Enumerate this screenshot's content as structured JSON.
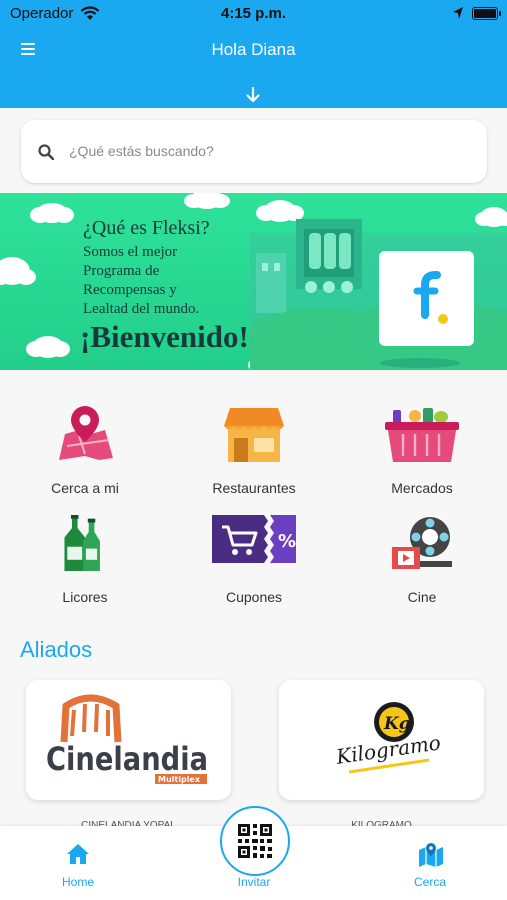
{
  "status_bar": {
    "carrier": "Operador",
    "time": "4:15 p.m."
  },
  "header": {
    "title": "Hola Diana"
  },
  "search": {
    "placeholder": "¿Qué estás buscando?"
  },
  "banner": {
    "title": "¿Qué es Fleksi?",
    "lines": [
      "Somos el mejor",
      "Programa de",
      "Recompensas y",
      "Lealtad del mundo."
    ],
    "headline": "¡Bienvenido!",
    "logo_letter": "f."
  },
  "categories": [
    {
      "label": "Cerca a mi",
      "icon": "map-pin-icon"
    },
    {
      "label": "Restaurantes",
      "icon": "store-icon"
    },
    {
      "label": "Mercados",
      "icon": "basket-icon"
    },
    {
      "label": "Licores",
      "icon": "bottles-icon"
    },
    {
      "label": "Cupones",
      "icon": "coupon-icon"
    },
    {
      "label": "Cine",
      "icon": "film-reel-icon"
    }
  ],
  "aliados": {
    "title": "Aliados",
    "items": [
      {
        "logo_text": "Cinelandia",
        "logo_sub": "Multiplex",
        "name": "CINELANDIA YOPAL"
      },
      {
        "logo_text": "Kilogramo",
        "logo_mark": "Kg",
        "name": "KILOGRAMO"
      }
    ]
  },
  "bottom_nav": {
    "home": "Home",
    "invite": "Invitar",
    "nearby": "Cerca"
  },
  "colors": {
    "primary": "#1aa9f0",
    "banner_green": "#2ee29a",
    "text_dark": "#333333"
  }
}
